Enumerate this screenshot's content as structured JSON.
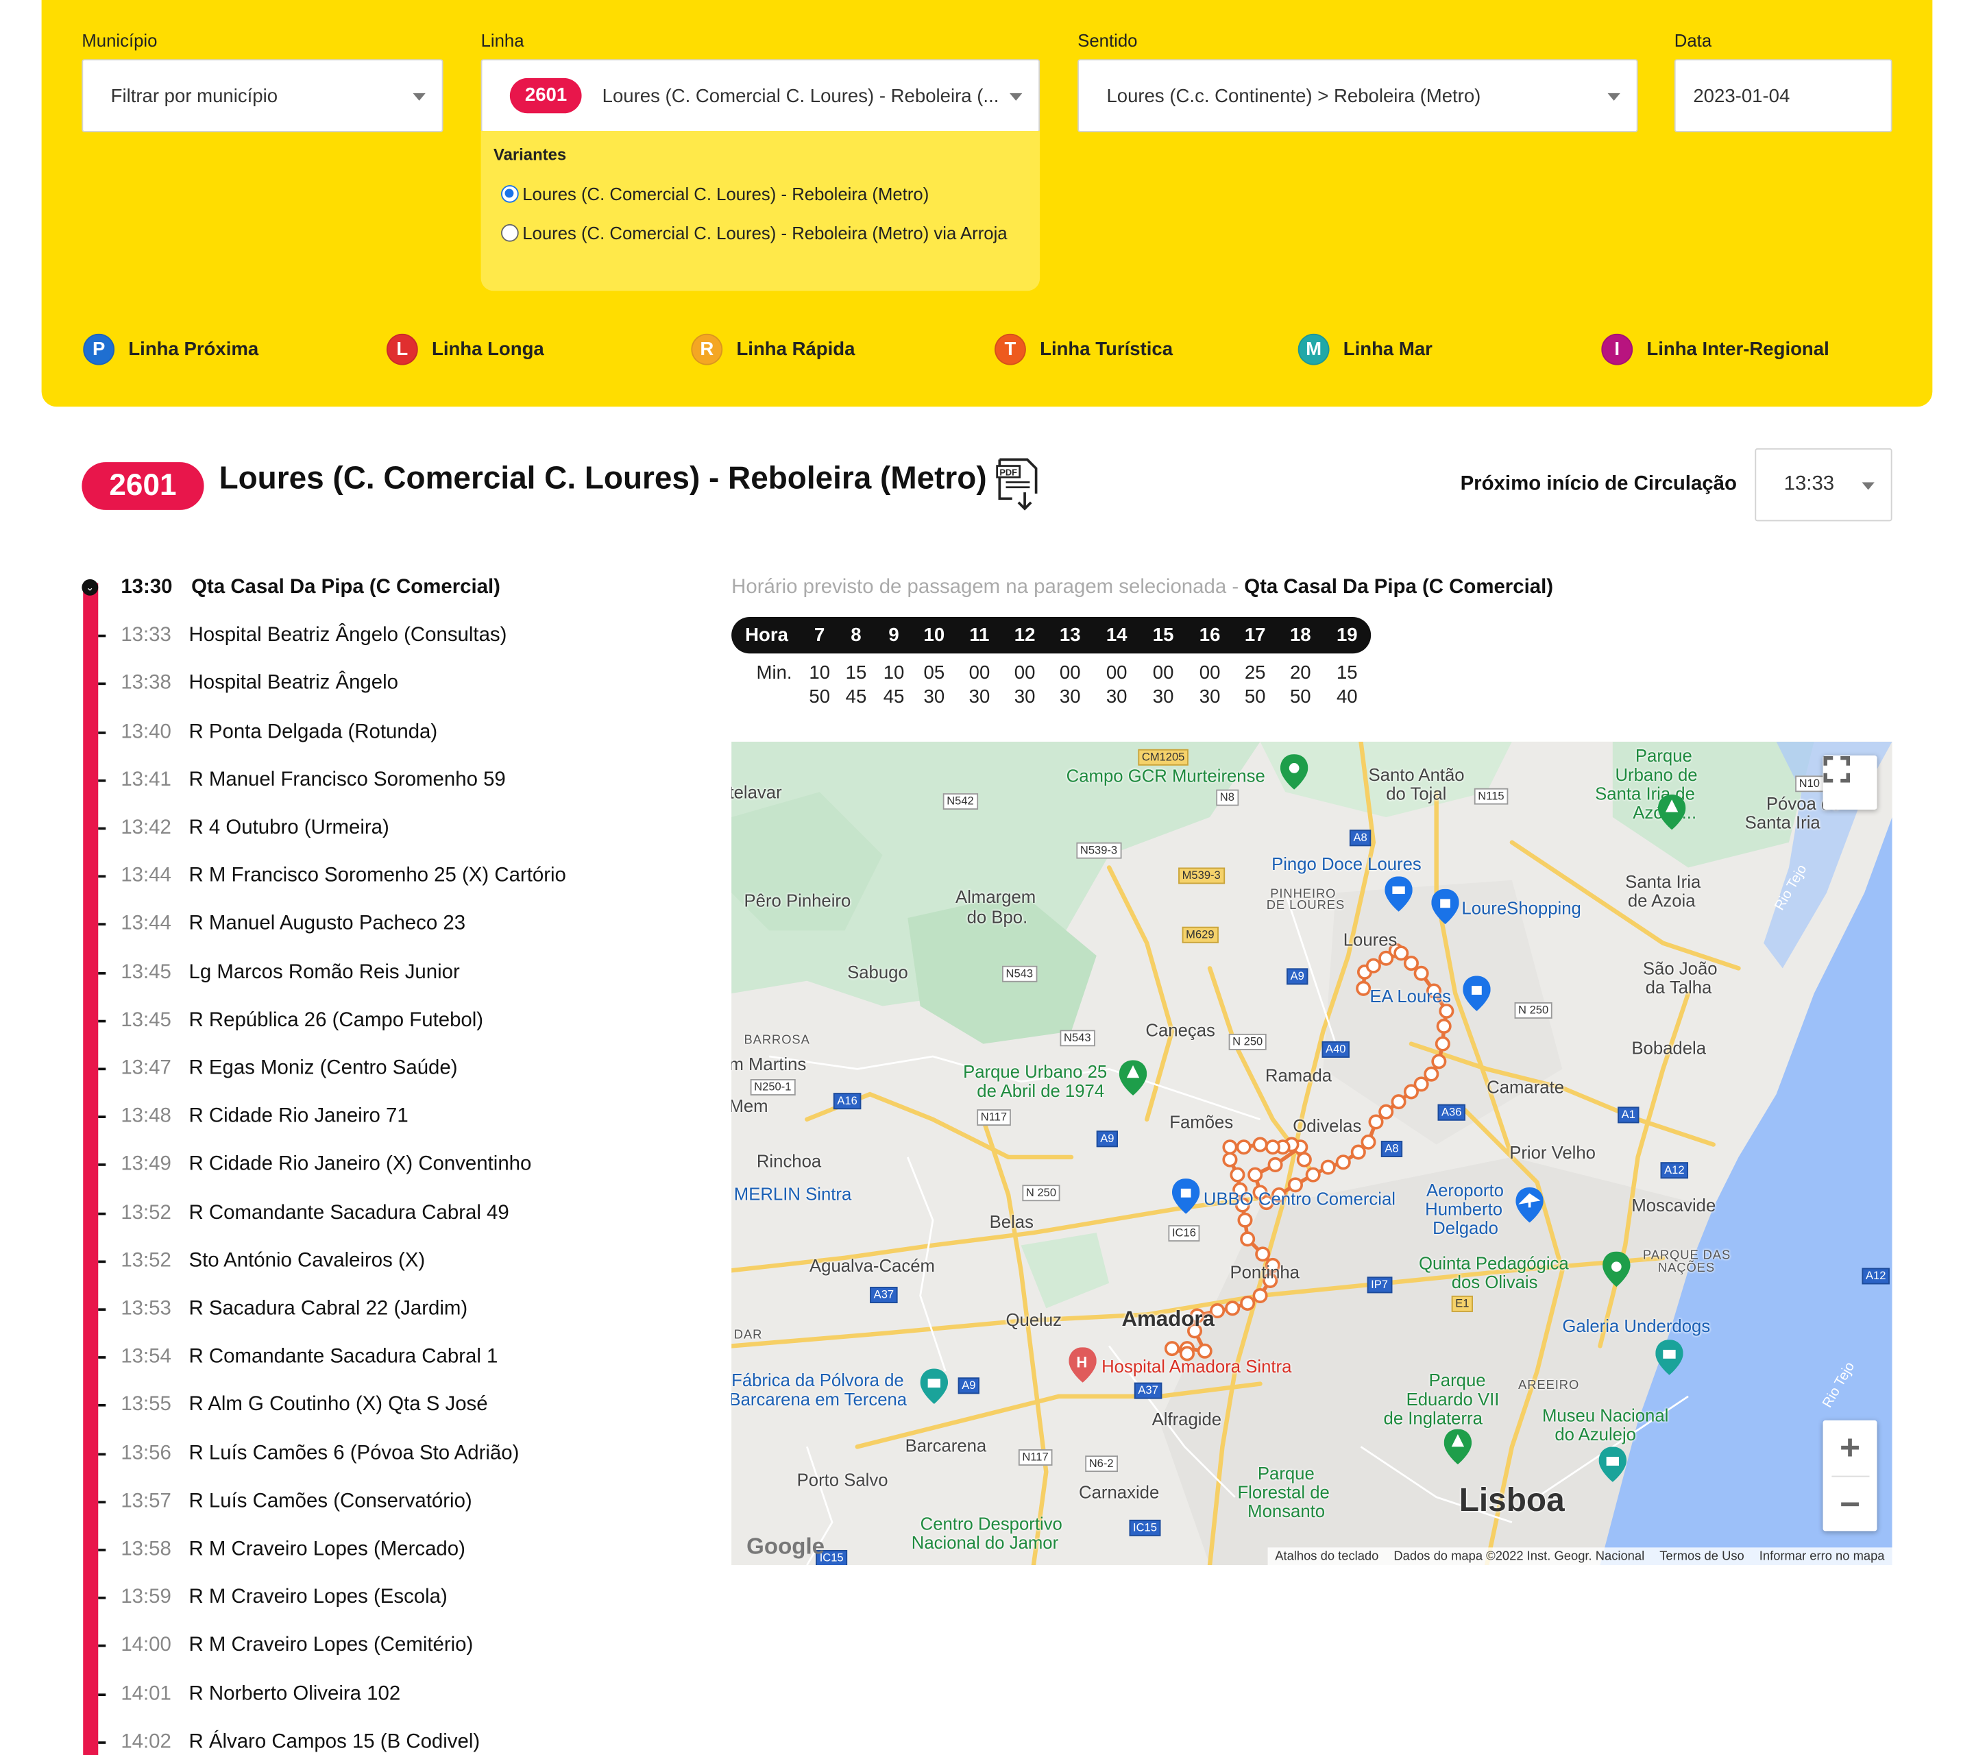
{
  "filters": {
    "municipio": {
      "label": "Município",
      "value": "Filtrar por município"
    },
    "linha": {
      "label": "Linha",
      "badge": "2601",
      "value": "Loures (C. Comercial C. Loures) - Reboleira (..."
    },
    "sentido": {
      "label": "Sentido",
      "value": "Loures (C.c. Continente) > Reboleira (Metro)"
    },
    "data": {
      "label": "Data",
      "value": "2023-01-04"
    }
  },
  "variants": {
    "title": "Variantes",
    "options": [
      {
        "label": "Loures (C. Comercial C. Loures) - Reboleira (Metro)",
        "selected": true
      },
      {
        "label": "Loures (C. Comercial C. Loures) - Reboleira (Metro) via Arroja",
        "selected": false
      }
    ]
  },
  "legend": [
    {
      "letter": "P",
      "label": "Linha Próxima",
      "color": "#1F6FD1"
    },
    {
      "letter": "L",
      "label": "Linha Longa",
      "color": "#E02F2F"
    },
    {
      "letter": "R",
      "label": "Linha Rápida",
      "color": "#F4A623"
    },
    {
      "letter": "T",
      "label": "Linha Turística",
      "color": "#EE5A1E"
    },
    {
      "letter": "M",
      "label": "Linha Mar",
      "color": "#22A8A8"
    },
    {
      "letter": "I",
      "label": "Linha Inter-Regional",
      "color": "#B8147F"
    }
  ],
  "line": {
    "number": "2601",
    "title": "Loures (C. Comercial C. Loures) - Reboleira (Metro)",
    "pdf_icon": "pdf-download-icon",
    "color": "#E8164B"
  },
  "next_start": {
    "label": "Próximo início de Circulação",
    "value": "13:33"
  },
  "stops": [
    {
      "time": "13:30",
      "name": "Qta Casal Da Pipa (C Comercial)"
    },
    {
      "time": "13:33",
      "name": "Hospital Beatriz Ângelo (Consultas)"
    },
    {
      "time": "13:38",
      "name": "Hospital Beatriz Ângelo"
    },
    {
      "time": "13:40",
      "name": "R Ponta Delgada (Rotunda)"
    },
    {
      "time": "13:41",
      "name": "R Manuel Francisco Soromenho 59"
    },
    {
      "time": "13:42",
      "name": "R 4 Outubro (Urmeira)"
    },
    {
      "time": "13:44",
      "name": "R M Francisco Soromenho 25 (X) Cartório"
    },
    {
      "time": "13:44",
      "name": "R Manuel Augusto Pacheco 23"
    },
    {
      "time": "13:45",
      "name": "Lg Marcos Romão Reis Junior"
    },
    {
      "time": "13:45",
      "name": "R República 26 (Campo Futebol)"
    },
    {
      "time": "13:47",
      "name": "R Egas Moniz (Centro Saúde)"
    },
    {
      "time": "13:48",
      "name": "R Cidade Rio Janeiro 71"
    },
    {
      "time": "13:49",
      "name": "R Cidade Rio Janeiro (X) Conventinho"
    },
    {
      "time": "13:52",
      "name": "R Comandante Sacadura Cabral 49"
    },
    {
      "time": "13:52",
      "name": "Sto António Cavaleiros (X)"
    },
    {
      "time": "13:53",
      "name": "R Sacadura Cabral 22 (Jardim)"
    },
    {
      "time": "13:54",
      "name": "R Comandante Sacadura Cabral 1"
    },
    {
      "time": "13:55",
      "name": "R Alm G Coutinho (X) Qta S José"
    },
    {
      "time": "13:56",
      "name": "R Luís Camões 6 (Póvoa Sto Adrião)"
    },
    {
      "time": "13:57",
      "name": "R Luís Camões (Conservatório)"
    },
    {
      "time": "13:58",
      "name": "R M Craveiro Lopes (Mercado)"
    },
    {
      "time": "13:59",
      "name": "R M Craveiro Lopes (Escola)"
    },
    {
      "time": "14:00",
      "name": "R M Craveiro Lopes (Cemitério)"
    },
    {
      "time": "14:01",
      "name": "R Norberto Oliveira 102"
    },
    {
      "time": "14:02",
      "name": "R Álvaro Campos 15 (B Codivel)"
    }
  ],
  "schedule": {
    "caption": "Horário previsto de passagem na paragem selecionada - ",
    "stop": "Qta Casal Da Pipa (C Comercial)",
    "hour_label": "Hora",
    "min_label": "Min.",
    "hours": [
      {
        "h": "7",
        "m": [
          "10",
          "50"
        ]
      },
      {
        "h": "8",
        "m": [
          "15",
          "45"
        ]
      },
      {
        "h": "9",
        "m": [
          "10",
          "45"
        ]
      },
      {
        "h": "10",
        "m": [
          "05",
          "30"
        ]
      },
      {
        "h": "11",
        "m": [
          "00",
          "30"
        ]
      },
      {
        "h": "12",
        "m": [
          "00",
          "30"
        ]
      },
      {
        "h": "13",
        "m": [
          "00",
          "30"
        ]
      },
      {
        "h": "14",
        "m": [
          "00",
          "30"
        ]
      },
      {
        "h": "15",
        "m": [
          "00",
          "30"
        ]
      },
      {
        "h": "16",
        "m": [
          "00",
          "30"
        ]
      },
      {
        "h": "17",
        "m": [
          "25",
          "50"
        ]
      },
      {
        "h": "18",
        "m": [
          "20",
          "50"
        ]
      },
      {
        "h": "19",
        "m": [
          "15",
          "40"
        ]
      }
    ]
  },
  "map": {
    "route_color": "#E8743B",
    "labels": {
      "telavar": "telavar",
      "campo_gcr": "Campo GCR Murteirense",
      "santo_antao": "Santo Antão",
      "do_tojal": "do Tojal",
      "parque_urbano_1": "Parque",
      "parque_urbano_2": "Urbano de",
      "parque_urbano_3": "Santa Iria de",
      "parque_urbano_4": "Azóia/...",
      "povoa_1": "Póvoa de",
      "povoa_2": "Santa Iria",
      "pingo_doce": "Pingo Doce Loures",
      "pinheiro_1": "PINHEIRO",
      "pinheiro_2": "DE LOURES",
      "loureshopping": "LoureShopping",
      "pero_pinheiro": "Pêro Pinheiro",
      "almargem_1": "Almargem",
      "almargem_2": "do Bpo.",
      "santa_iria_1": "Santa Iria",
      "santa_iria_2": "de Azoia",
      "loures": "Loures",
      "sabugo": "Sabugo",
      "ikea": "EA Loures",
      "sao_joao_1": "São João",
      "sao_joao_2": "da Talha",
      "barrosa": "BARROSA",
      "canecas": "Caneças",
      "martins": "m Martins",
      "parque25_1": "Parque Urbano 25",
      "parque25_2": "de Abril de 1974",
      "ramada": "Ramada",
      "bobadela": "Bobadela",
      "camarate": "Camarate",
      "mem": "Mem",
      "famoes": "Famões",
      "odivelas": "Odivelas",
      "prior_velho": "Prior Velho",
      "rinchoa": "Rinchoa",
      "merlin": "MERLIN Sintra",
      "ubbo": "UBBO Centro Comercial",
      "aeroporto_1": "Aeroporto",
      "aeroporto_2": "Humberto",
      "aeroporto_3": "Delgado",
      "moscavide": "Moscavide",
      "belas": "Belas",
      "agualva": "Agualva-Cacém",
      "pontinha": "Pontinha",
      "quinta_1": "Quinta Pedagógica",
      "quinta_2": "dos Olivais",
      "parque_nacoes_1": "PARQUE DAS",
      "parque_nacoes_2": "NAÇÕES",
      "queluz": "Queluz",
      "amadora": "Amadora",
      "dar": "DAR",
      "galeria": "Galeria Underdogs",
      "fabrica_1": "Fábrica da Pólvora de",
      "fabrica_2": "Barcarena em Tercena",
      "hospital": "Hospital Amadora Sintra",
      "areeiro": "AREEIRO",
      "parque_eduardo_1": "Parque",
      "parque_eduardo_2": "Eduardo VII",
      "parque_eduardo_3": "de Inglaterra",
      "museu_1": "Museu Nacional",
      "museu_2": "do Azulejo",
      "alfragide": "Alfragide",
      "barcarena": "Barcarena",
      "porto_salvo": "Porto Salvo",
      "carnaxide": "Carnaxide",
      "monsanto_1": "Parque",
      "monsanto_2": "Florestal de",
      "monsanto_3": "Monsanto",
      "lisboa": "Lisboa",
      "jamor_1": "Centro Desportivo",
      "jamor_2": "Nacional do Jamor",
      "rio_tejo_1": "Rio Tejo",
      "rio_tejo_2": "Rio Tejo"
    },
    "roads": [
      "CM1205",
      "N8",
      "N115",
      "N542",
      "N539-3",
      "A8",
      "M539-3",
      "M629",
      "N10",
      "N543",
      "A9",
      "N 250",
      "N543",
      "N 250",
      "A40",
      "A36",
      "N250-1",
      "A16",
      "N117",
      "A9",
      "A1",
      "A8",
      "A12",
      "N 250",
      "IC16",
      "IP7",
      "E1",
      "A37",
      "A9",
      "A37",
      "A12",
      "N117",
      "N6-2",
      "IC15",
      "IC15"
    ],
    "attribution": [
      "Atalhos do teclado",
      "Dados do mapa ©2022 Inst. Geogr. Nacional",
      "Termos de Uso",
      "Informar erro no mapa"
    ],
    "logo": "Google",
    "controls": {
      "fullscreen_icon": "fullscreen-icon",
      "zoom_in": "+",
      "zoom_out": "−"
    }
  }
}
